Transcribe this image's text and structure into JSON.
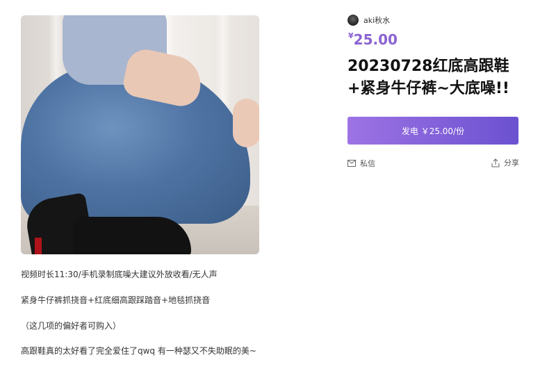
{
  "seller": {
    "name": "aki秋水"
  },
  "price": {
    "currency": "¥",
    "amount": "25.00"
  },
  "product": {
    "title_line1": "20230728红底高跟鞋",
    "title_line2": "+紧身牛仔裤~大底噪!!"
  },
  "actions": {
    "buy_label": "发电 ￥25.00/份",
    "message_label": "私信",
    "share_label": "分享"
  },
  "description": [
    "视频时长11:30/手机录制底噪大建议外放收看/无人声",
    "紧身牛仔裤抓挠音+红底细高跟踩踏音+地毯抓挠音",
    "（这几项的偏好者可购入）",
    "高跟鞋真的太好看了完全爱住了qwq 有一种瑟又不失助眠的美~"
  ],
  "icons": [
    "mail-icon",
    "share-icon"
  ],
  "colors": {
    "accent": "#8a63d2",
    "button_start": "#9d73e4",
    "button_end": "#6b51d0"
  }
}
